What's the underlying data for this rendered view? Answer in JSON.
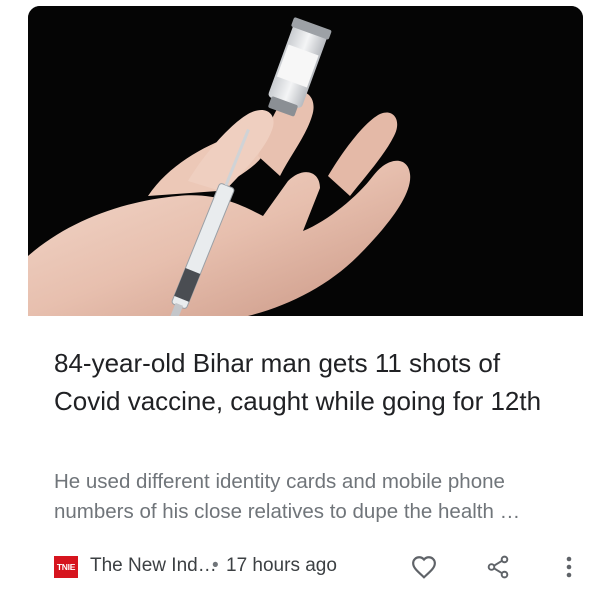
{
  "article": {
    "title": "84-year-old Bihar man gets 11 shots of Covid vaccine, caught while going for 12th",
    "snippet": "He used different identity cards and mobile phone numbers of his close relatives to dupe the health …",
    "source_logo_text": "TNIE",
    "source_name": "The New Ind…",
    "separator": "•",
    "time_ago": "17 hours ago",
    "image_subject": "hand holding syringe drawing from a vaccine vial"
  },
  "actions": {
    "like_icon": "heart-outline-icon",
    "share_icon": "share-icon",
    "more_icon": "more-vert-icon"
  },
  "colors": {
    "title": "#202124",
    "snippet": "#70757a",
    "logo_bg": "#d6141e",
    "hero_bg": "#050505",
    "icon": "#5f6368"
  }
}
